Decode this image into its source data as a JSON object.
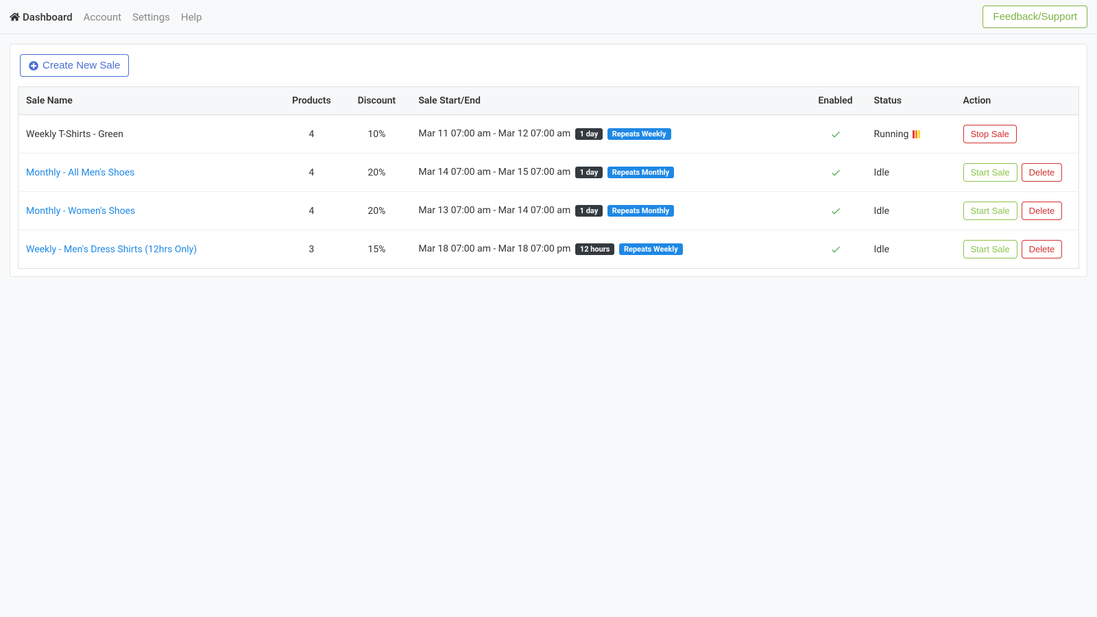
{
  "nav": {
    "dashboard": "Dashboard",
    "account": "Account",
    "settings": "Settings",
    "help": "Help"
  },
  "feedback_label": "Feedback/Support",
  "create_label": "Create New Sale",
  "table": {
    "headers": {
      "sale_name": "Sale Name",
      "products": "Products",
      "discount": "Discount",
      "start_end": "Sale Start/End",
      "enabled": "Enabled",
      "status": "Status",
      "action": "Action"
    },
    "rows": [
      {
        "name": "Weekly T-Shirts - Green",
        "name_is_link": false,
        "products": "4",
        "discount": "10%",
        "date_range": "Mar 11 07:00 am - Mar 12 07:00 am",
        "duration": "1 day",
        "repeat": "Repeats Weekly",
        "enabled": true,
        "status": "Running",
        "running": true,
        "actions": {
          "stop": "Stop Sale"
        }
      },
      {
        "name": "Monthly - All Men's Shoes",
        "name_is_link": true,
        "products": "4",
        "discount": "20%",
        "date_range": "Mar 14 07:00 am - Mar 15 07:00 am",
        "duration": "1 day",
        "repeat": "Repeats Monthly",
        "enabled": true,
        "status": "Idle",
        "running": false,
        "actions": {
          "start": "Start Sale",
          "delete": "Delete"
        }
      },
      {
        "name": "Monthly - Women's Shoes",
        "name_is_link": true,
        "products": "4",
        "discount": "20%",
        "date_range": "Mar 13 07:00 am - Mar 14 07:00 am",
        "duration": "1 day",
        "repeat": "Repeats Monthly",
        "enabled": true,
        "status": "Idle",
        "running": false,
        "actions": {
          "start": "Start Sale",
          "delete": "Delete"
        }
      },
      {
        "name": "Weekly - Men's Dress Shirts (12hrs Only)",
        "name_is_link": true,
        "products": "3",
        "discount": "15%",
        "date_range": "Mar 18 07:00 am - Mar 18 07:00 pm",
        "duration": "12 hours",
        "repeat": "Repeats Weekly",
        "enabled": true,
        "status": "Idle",
        "running": false,
        "actions": {
          "start": "Start Sale",
          "delete": "Delete"
        }
      }
    ]
  }
}
